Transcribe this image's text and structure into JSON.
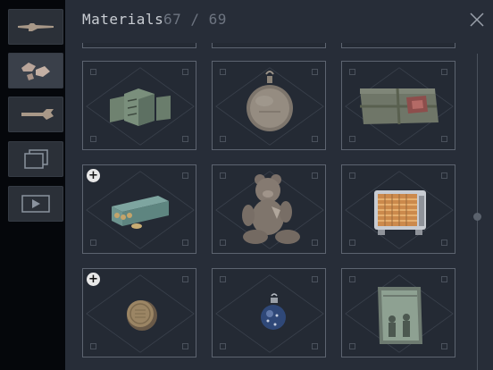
{
  "panel": {
    "title": "Materials",
    "count": "67 / 69"
  },
  "sidebar": {
    "items": [
      {
        "name": "weapon-tab",
        "icon": "rifle-icon",
        "active": false
      },
      {
        "name": "materials-tab",
        "icon": "materials-icon",
        "active": true
      },
      {
        "name": "tools-tab",
        "icon": "wrench-icon",
        "active": false
      },
      {
        "name": "gallery-tab",
        "icon": "cards-icon",
        "active": false
      },
      {
        "name": "video-tab",
        "icon": "play-icon",
        "active": false
      }
    ]
  },
  "grid": {
    "items": [
      {
        "icon": "crates-icon",
        "plus": false
      },
      {
        "icon": "pocket-watch-icon",
        "plus": false
      },
      {
        "icon": "parcel-icon",
        "plus": false
      },
      {
        "icon": "ammo-box-icon",
        "plus": true
      },
      {
        "icon": "teddy-bear-icon",
        "plus": false
      },
      {
        "icon": "heater-icon",
        "plus": false
      },
      {
        "icon": "coin-icon",
        "plus": true
      },
      {
        "icon": "ornament-icon",
        "plus": false
      },
      {
        "icon": "photo-frame-icon",
        "plus": false
      }
    ],
    "plus_symbol": "+"
  },
  "colors": {
    "panel_bg": "#272d38",
    "slot_border": "#5d6470",
    "title_text": "#c9cdd3",
    "count_text": "#6d7480"
  }
}
